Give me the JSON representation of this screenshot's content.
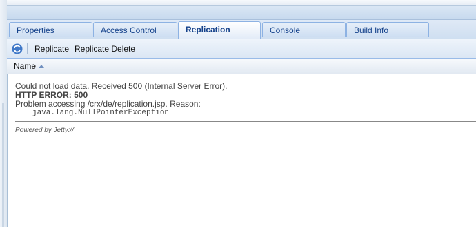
{
  "tabs": [
    {
      "label": "Properties",
      "active": false
    },
    {
      "label": "Access Control",
      "active": false
    },
    {
      "label": "Replication",
      "active": true
    },
    {
      "label": "Console",
      "active": false
    },
    {
      "label": "Build Info",
      "active": false
    }
  ],
  "toolbar": {
    "refresh_icon": "refresh-icon",
    "replicate_label": "Replicate",
    "replicate_delete_label": "Replicate Delete"
  },
  "grid": {
    "column_name": "Name",
    "sort": "ascending"
  },
  "message": {
    "error_line": "Could not load data. Received 500 (Internal Server Error).",
    "http_error": "HTTP ERROR: 500",
    "problem_line": "Problem accessing /crx/de/replication.jsp. Reason:",
    "exception": "java.lang.NullPointerException",
    "powered_by": "Powered by Jetty://"
  },
  "colors": {
    "tab_text": "#15428b",
    "border": "#99bbe8",
    "header_band": "#c7d9ee"
  }
}
